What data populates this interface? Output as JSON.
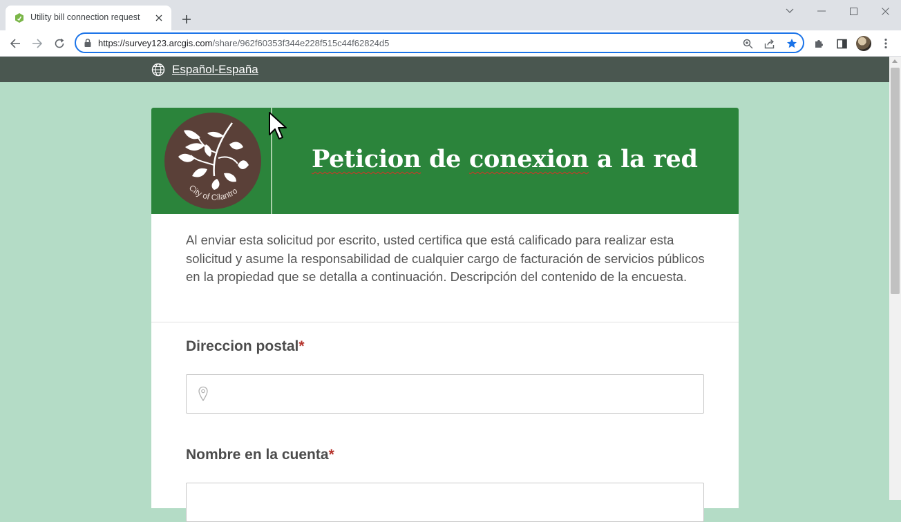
{
  "browser": {
    "tab_title": "Utility bill connection request",
    "url_host": "https://survey123.arcgis.com",
    "url_path": "/share/962f60353f344e228f515c44f62824d5",
    "icons": [
      "survey123-favicon",
      "close-icon",
      "plus-icon",
      "chevron-down-icon",
      "minimize-icon",
      "maximize-icon",
      "close-window-icon",
      "back-arrow-icon",
      "forward-arrow-icon",
      "refresh-icon",
      "lock-icon",
      "zoom-icon",
      "share-icon",
      "star-icon",
      "puzzle-icon",
      "sidepanel-icon",
      "kebab-menu-icon"
    ],
    "accent": "#1a73e8"
  },
  "page": {
    "language_link": "Español-España",
    "logo_text": "City of Cilantro",
    "title_parts": [
      "Peticion",
      " de ",
      "conexion",
      " a la red"
    ],
    "description": "Al enviar esta solicitud por escrito, usted certifica que está calificado para realizar esta solicitud y asume la responsabilidad de cualquier cargo de facturación de servicios públicos en la propiedad que se detalla a continuación. Descripción del contenido de la encuesta.",
    "required_mark": "*",
    "fields": [
      {
        "label": "Direccion postal",
        "value": ""
      },
      {
        "label": "Nombre en la cuenta",
        "value": ""
      }
    ],
    "colors": {
      "background": "#b4dcc6",
      "lang_bar": "#4a5750",
      "header": "#2b843b",
      "logo_circle": "#5a4038",
      "required": "#b5322b"
    }
  }
}
